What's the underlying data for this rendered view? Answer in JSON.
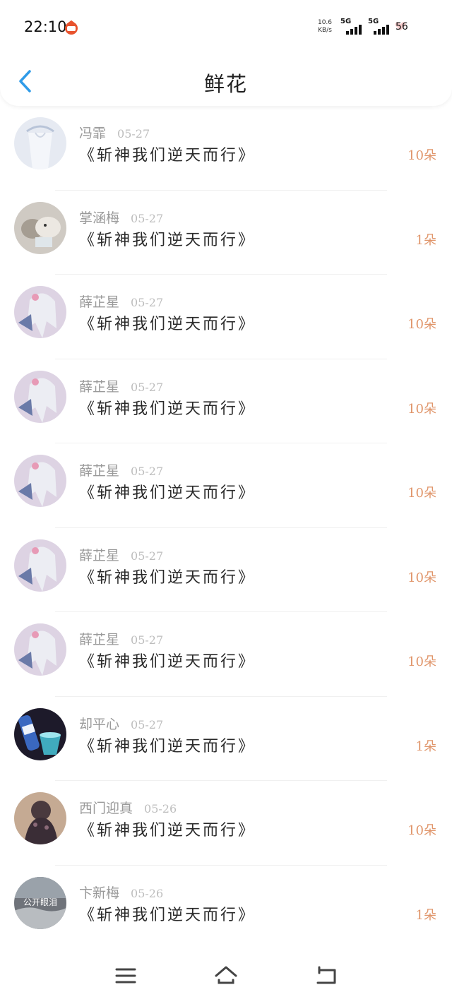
{
  "status_bar": {
    "time": "22:10",
    "net_speed_value": "10.6",
    "net_speed_unit": "KB/s",
    "sim1_label": "5G",
    "sim2_label": "5G",
    "battery": "56"
  },
  "header": {
    "title": "鲜花",
    "back_icon": "chevron-left-icon",
    "accent_color": "#2f9be8"
  },
  "colors": {
    "amount": "#e0956a",
    "name": "#9a9a9a",
    "date": "#bdbdbd"
  },
  "list": {
    "items": [
      {
        "name": "冯霏",
        "date": "05-27",
        "book": "《斩神我们逆天而行》",
        "amount": "10朵"
      },
      {
        "name": "掌涵梅",
        "date": "05-27",
        "book": "《斩神我们逆天而行》",
        "amount": "1朵"
      },
      {
        "name": "薛芷星",
        "date": "05-27",
        "book": "《斩神我们逆天而行》",
        "amount": "10朵"
      },
      {
        "name": "薛芷星",
        "date": "05-27",
        "book": "《斩神我们逆天而行》",
        "amount": "10朵"
      },
      {
        "name": "薛芷星",
        "date": "05-27",
        "book": "《斩神我们逆天而行》",
        "amount": "10朵"
      },
      {
        "name": "薛芷星",
        "date": "05-27",
        "book": "《斩神我们逆天而行》",
        "amount": "10朵"
      },
      {
        "name": "薛芷星",
        "date": "05-27",
        "book": "《斩神我们逆天而行》",
        "amount": "10朵"
      },
      {
        "name": "却平心",
        "date": "05-27",
        "book": "《斩神我们逆天而行》",
        "amount": "1朵"
      },
      {
        "name": "西门迎真",
        "date": "05-26",
        "book": "《斩神我们逆天而行》",
        "amount": "10朵"
      },
      {
        "name": "卞新梅",
        "date": "05-26",
        "book": "《斩神我们逆天而行》",
        "amount": "1朵"
      }
    ],
    "avatar_overlay_text": "公开眼泪"
  },
  "bottom_nav": {
    "menu_icon": "menu-icon",
    "home_icon": "home-icon",
    "back_icon": "return-icon"
  }
}
